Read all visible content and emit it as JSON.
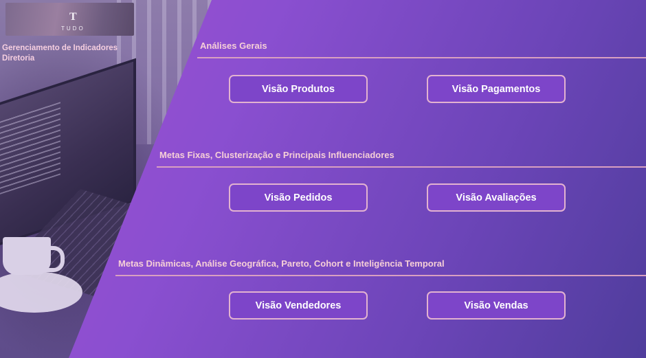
{
  "brand": {
    "logo_mark": "T",
    "logo_text": "TUDO"
  },
  "header": {
    "title_line1": "Gerenciamento de Indicadores",
    "title_line2": "Diretoria"
  },
  "sections": [
    {
      "title": "Análises Gerais",
      "buttons": [
        "Visão Produtos",
        "Visão Pagamentos"
      ]
    },
    {
      "title": "Metas Fixas, Clusterização e Principais Influenciadores",
      "buttons": [
        "Visão Pedidos",
        "Visão Avaliações"
      ]
    },
    {
      "title": "Metas Dinâmicas, Análise Geográfica, Pareto, Cohort e Inteligência Temporal",
      "buttons": [
        "Visão Vendedores",
        "Visão Vendas"
      ]
    }
  ],
  "colors": {
    "accent": "#7d45c9",
    "button_border": "#e3b3d0",
    "section_text": "#f6cfd7"
  }
}
